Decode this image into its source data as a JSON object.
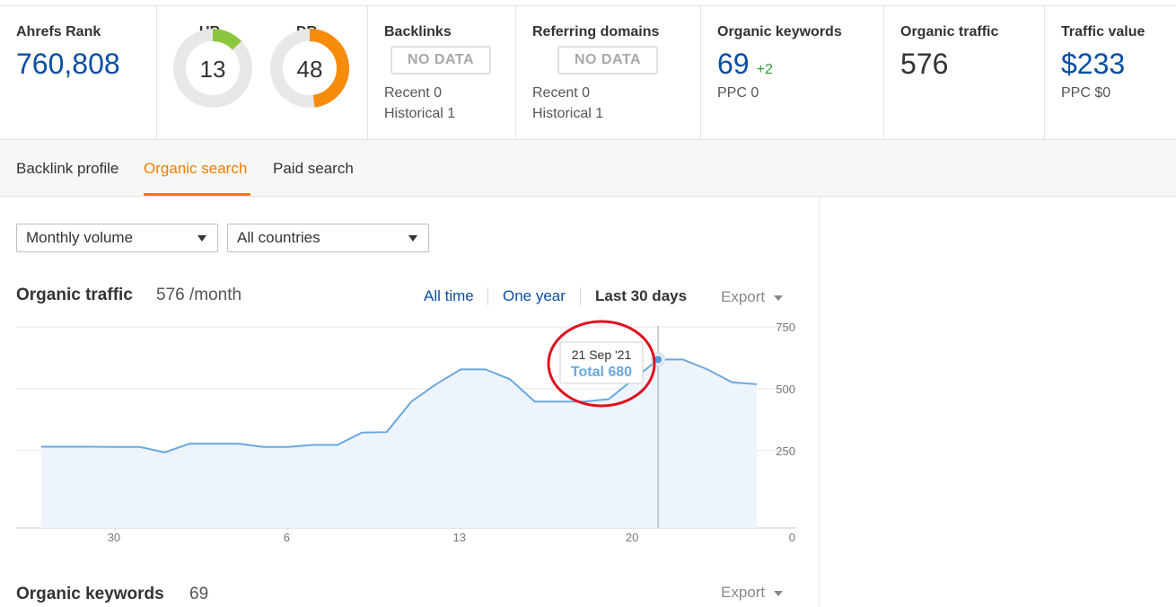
{
  "metrics": {
    "ahrefs_rank": {
      "label": "Ahrefs Rank",
      "value": "760,808"
    },
    "ur": {
      "label": "UR",
      "value": "13",
      "score": 13
    },
    "dr": {
      "label": "DR",
      "value": "48",
      "score": 48
    },
    "backlinks": {
      "label": "Backlinks",
      "badge": "NO DATA",
      "recent": "Recent 0",
      "historical": "Historical 1"
    },
    "referring_domains": {
      "label": "Referring domains",
      "badge": "NO DATA",
      "recent": "Recent 0",
      "historical": "Historical 1"
    },
    "organic_keywords": {
      "label": "Organic keywords",
      "value": "69",
      "delta": "+2",
      "ppc": "PPC 0"
    },
    "organic_traffic": {
      "label": "Organic traffic",
      "value": "576"
    },
    "traffic_value": {
      "label": "Traffic value",
      "value": "$233",
      "ppc": "PPC $0"
    }
  },
  "tabs": [
    {
      "label": "Backlink profile",
      "active": false
    },
    {
      "label": "Organic search",
      "active": true
    },
    {
      "label": "Paid search",
      "active": false
    }
  ],
  "filters": {
    "volume": "Monthly volume",
    "country": "All countries"
  },
  "traffic_section": {
    "title": "Organic traffic",
    "value": "576 /month",
    "ranges": [
      "All time",
      "One year",
      "Last 30 days"
    ],
    "active_range": "Last 30 days",
    "export_label": "Export"
  },
  "keywords_section": {
    "title": "Organic keywords",
    "value": "69",
    "export_label": "Export"
  },
  "tooltip": {
    "date": "21 Sep '21",
    "total": "Total 680"
  },
  "colors": {
    "link": "#0b4ea2",
    "accent": "#f57c00",
    "ur_arc": "#8cc63f",
    "dr_arc": "#f98b0b",
    "line": "#6aa8dd",
    "area": "#eef4fc",
    "annotation": "#e0101e"
  },
  "chart_data": {
    "type": "area",
    "x": [
      "27 Aug",
      "28 Aug",
      "29 Aug",
      "30 Aug",
      "31 Aug",
      "1 Sep",
      "2 Sep",
      "3 Sep",
      "4 Sep",
      "5 Sep",
      "6 Sep",
      "7 Sep",
      "8 Sep",
      "9 Sep",
      "10 Sep",
      "11 Sep",
      "12 Sep",
      "13 Sep",
      "14 Sep",
      "15 Sep",
      "16 Sep",
      "17 Sep",
      "18 Sep",
      "19 Sep",
      "20 Sep",
      "21 Sep",
      "22 Sep",
      "23 Sep",
      "24 Sep",
      "25 Sep"
    ],
    "values": [
      328,
      328,
      328,
      327,
      327,
      305,
      340,
      340,
      340,
      327,
      327,
      335,
      335,
      385,
      387,
      510,
      580,
      640,
      640,
      600,
      510,
      510,
      510,
      520,
      600,
      680,
      680,
      640,
      588,
      580
    ],
    "x_tick_labels": [
      "30",
      "6",
      "13",
      "20"
    ],
    "x_tick_index": [
      3,
      10,
      17,
      24
    ],
    "y_tick_labels": [
      "750",
      "500",
      "250",
      "0"
    ],
    "ylim": [
      0,
      750
    ],
    "highlight_index": 25,
    "grid": true
  }
}
